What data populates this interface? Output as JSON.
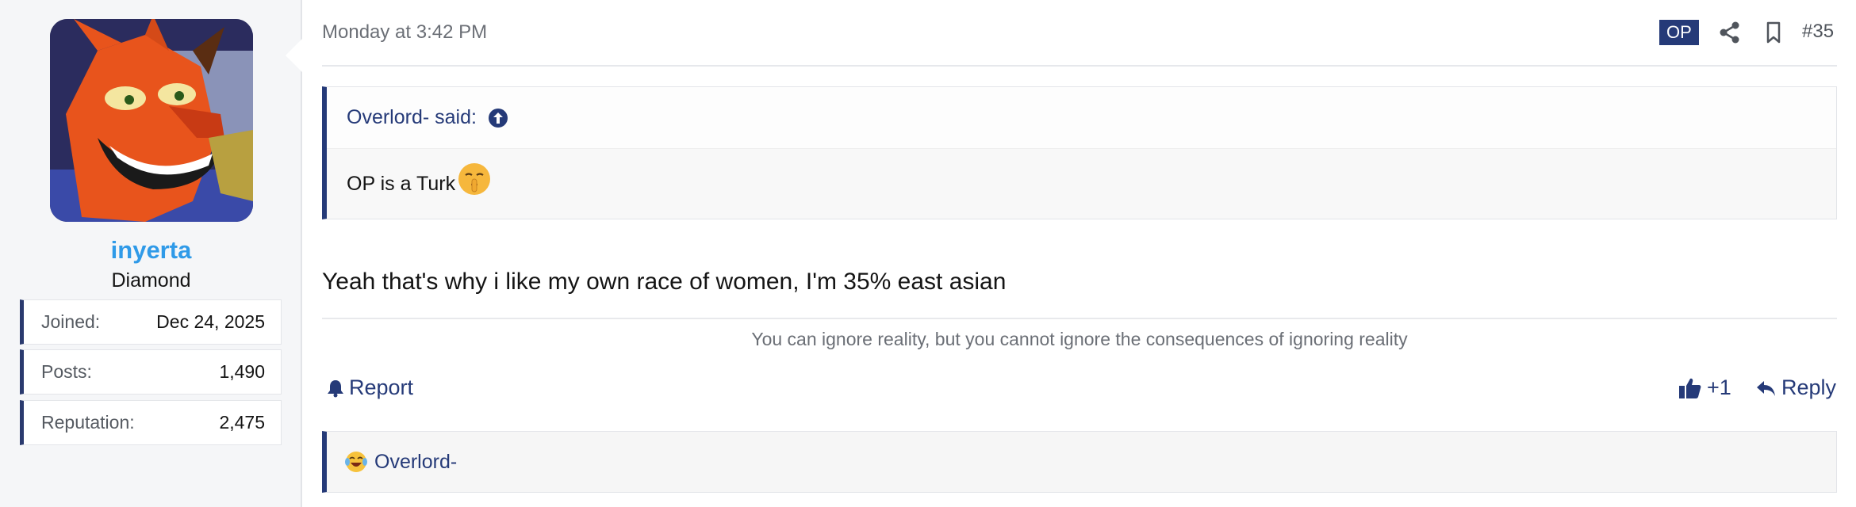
{
  "user": {
    "username": "inyerta",
    "title": "Diamond",
    "stats": [
      {
        "label": "Joined:",
        "value": "Dec 24, 2025"
      },
      {
        "label": "Posts:",
        "value": "1,490"
      },
      {
        "label": "Reputation:",
        "value": "2,475"
      }
    ]
  },
  "post": {
    "timestamp": "Monday at 3:42 PM",
    "op_badge": "OP",
    "number": "#35",
    "icons": [
      "share-icon",
      "bookmark-icon"
    ],
    "quote": {
      "author": "Overlord- said:",
      "text": "OP is a Turk",
      "emoji": "shushing-face-icon"
    },
    "message": "Yeah that's why i like my own race of women, I'm 35% east asian",
    "signature": "You can ignore reality, but you cannot ignore the consequences of ignoring reality",
    "actions": {
      "report": "Report",
      "like": "+1",
      "reply": "Reply"
    },
    "reactions": {
      "emoji": "laughing-crying-face-icon",
      "users": "Overlord-"
    }
  },
  "colors": {
    "accent": "#253a78",
    "username": "#2f9ae8",
    "sidebar_bg": "#f5f6f8"
  }
}
